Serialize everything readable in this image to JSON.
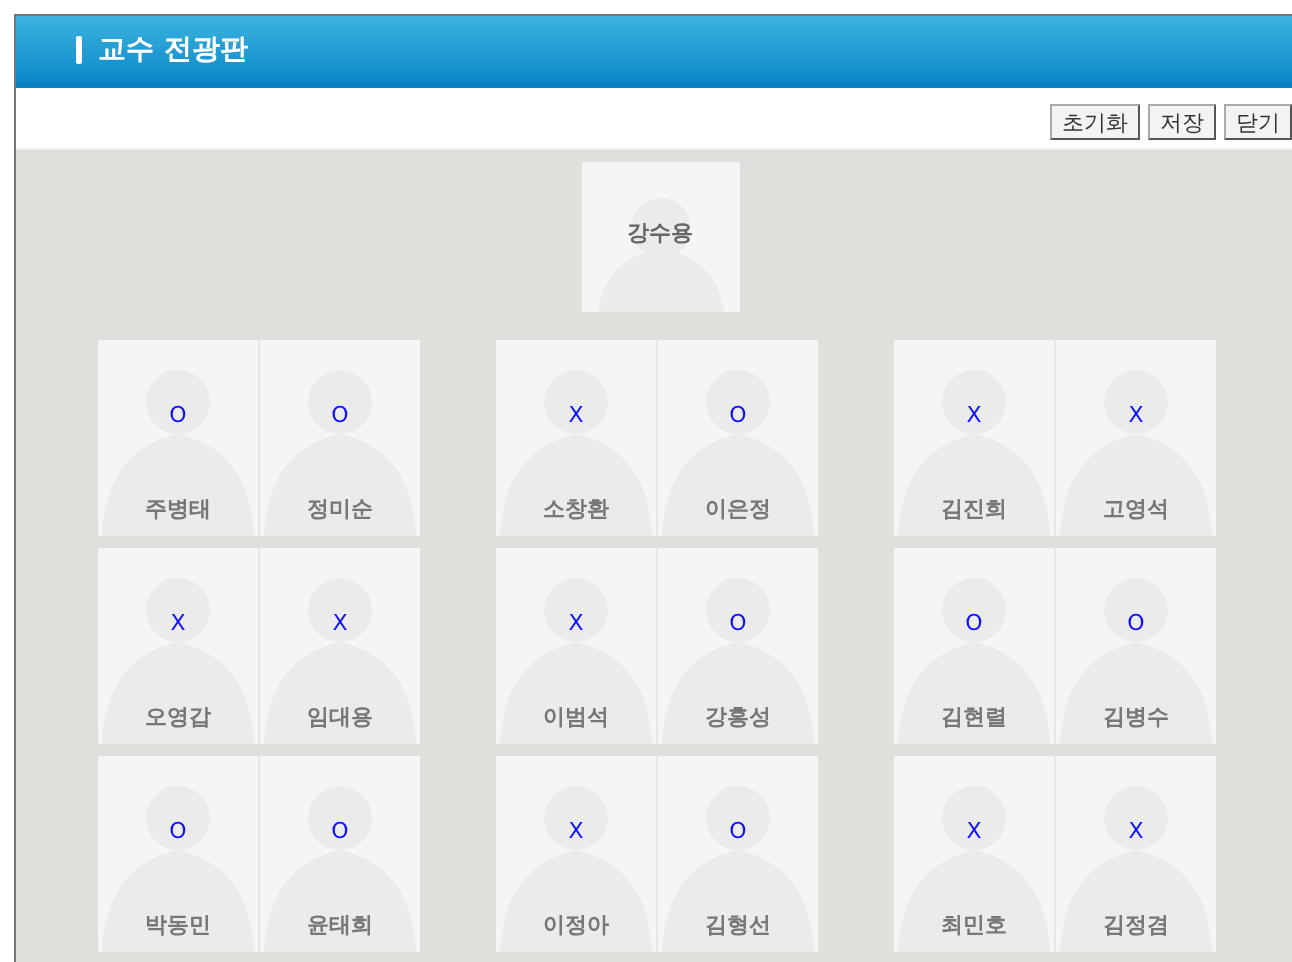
{
  "window": {
    "title": "교수 전광판"
  },
  "buttons": [
    "초기화",
    "저장",
    "닫기"
  ],
  "head": {
    "name": "강수용"
  },
  "rows": [
    {
      "pairs": [
        [
          {
            "mark": "O",
            "name": "주병태"
          },
          {
            "mark": "O",
            "name": "정미순"
          }
        ],
        [
          {
            "mark": "X",
            "name": "소창환"
          },
          {
            "mark": "O",
            "name": "이은정"
          }
        ],
        [
          {
            "mark": "X",
            "name": "김진희"
          },
          {
            "mark": "X",
            "name": "고영석"
          }
        ]
      ]
    },
    {
      "pairs": [
        [
          {
            "mark": "X",
            "name": "오영갑"
          },
          {
            "mark": "X",
            "name": "임대용"
          }
        ],
        [
          {
            "mark": "X",
            "name": "이범석"
          },
          {
            "mark": "O",
            "name": "강홍성"
          }
        ],
        [
          {
            "mark": "O",
            "name": "김현렬"
          },
          {
            "mark": "O",
            "name": "김병수"
          }
        ]
      ]
    },
    {
      "pairs": [
        [
          {
            "mark": "O",
            "name": "박동민"
          },
          {
            "mark": "O",
            "name": "윤태희"
          }
        ],
        [
          {
            "mark": "X",
            "name": "이정아"
          },
          {
            "mark": "O",
            "name": "김형선"
          }
        ],
        [
          {
            "mark": "X",
            "name": "최민호"
          },
          {
            "mark": "X",
            "name": "김정겸"
          }
        ]
      ]
    }
  ]
}
